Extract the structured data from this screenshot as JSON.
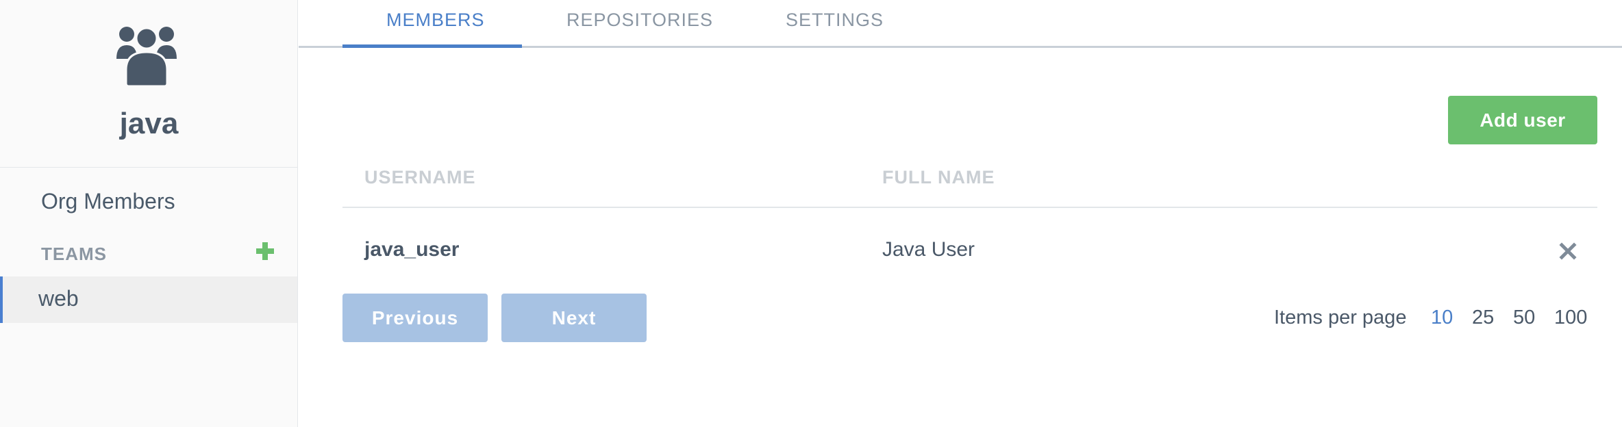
{
  "org": {
    "name": "java",
    "icon": "users-group-icon"
  },
  "sidebar": {
    "org_members_label": "Org Members",
    "teams_label": "TEAMS",
    "add_team_icon": "plus-icon",
    "teams": [
      {
        "label": "web",
        "selected": true
      }
    ]
  },
  "tabs": [
    {
      "label": "MEMBERS",
      "active": true
    },
    {
      "label": "REPOSITORIES",
      "active": false
    },
    {
      "label": "SETTINGS",
      "active": false
    }
  ],
  "actions": {
    "add_user_label": "Add user"
  },
  "table": {
    "columns": [
      "USERNAME",
      "FULL NAME"
    ],
    "rows": [
      {
        "username": "java_user",
        "full_name": "Java User",
        "remove_icon": "close-icon"
      }
    ]
  },
  "pagination": {
    "previous_label": "Previous",
    "next_label": "Next",
    "items_per_page_label": "Items per page",
    "options": [
      "10",
      "25",
      "50",
      "100"
    ],
    "selected": "10"
  },
  "colors": {
    "accent": "#4a7fc8",
    "success": "#6bbf6e",
    "disabled_button": "#a7c2e3",
    "text": "#4a5868",
    "muted": "#8b96a2"
  }
}
